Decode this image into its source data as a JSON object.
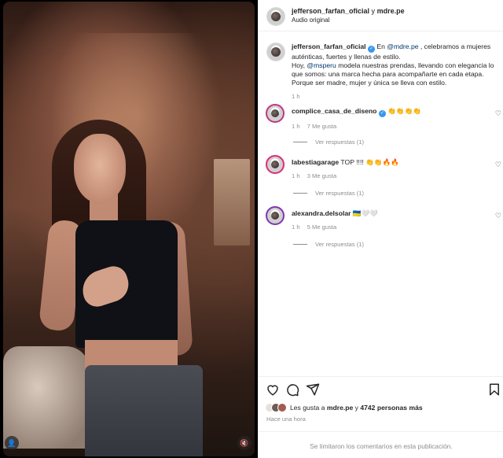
{
  "header": {
    "username": "jefferson_farfan_oficial",
    "joiner": "y",
    "collaborator": "mdre.pe",
    "audio": "Audio original"
  },
  "caption": {
    "username": "jefferson_farfan_oficial",
    "verified": "✓",
    "p1_a": " En ",
    "p1_mention": "@mdre.pe",
    "p1_b": " , celebramos a mujeres auténticas, fuertes y llenas de estilo.",
    "p2_a": "Hoy, ",
    "p2_mention": "@msperu",
    "p2_b": " modela nuestras prendas, llevando con elegancia lo que somos: una marca hecha para acompañarte en cada etapa. Porque ser madre, mujer y única se lleva con estilo.",
    "time": "1 h"
  },
  "comments": [
    {
      "username": "complice_casa_de_diseno",
      "verified": "✓",
      "text": "👏👏👏👏",
      "time": "1 h",
      "likes": "7 Me gusta",
      "replies": "Ver respuestas (1)"
    },
    {
      "username": "labestiagarage",
      "text": "TOP !!!! 👏👏🔥🔥",
      "time": "1 h",
      "likes": "3 Me gusta",
      "replies": "Ver respuestas (1)"
    },
    {
      "username": "alexandra.delsolar",
      "text": "🇺🇦🤍🤍",
      "time": "1 h",
      "likes": "5 Me gusta",
      "replies": "Ver respuestas (1)"
    }
  ],
  "likes": {
    "prefix": "Les gusta a ",
    "user": "mdre.pe",
    "mid": " y ",
    "count": "4742 personas más"
  },
  "posted": "Hace una hora",
  "limited": "Se limitaron los comentarios en esta publicación.",
  "icons": {
    "user": "👤",
    "mute": "🔇",
    "heart": "♡"
  },
  "colors": {
    "verified": "#3897f0",
    "mention": "#00376b",
    "muted": "#8e8e8e"
  }
}
